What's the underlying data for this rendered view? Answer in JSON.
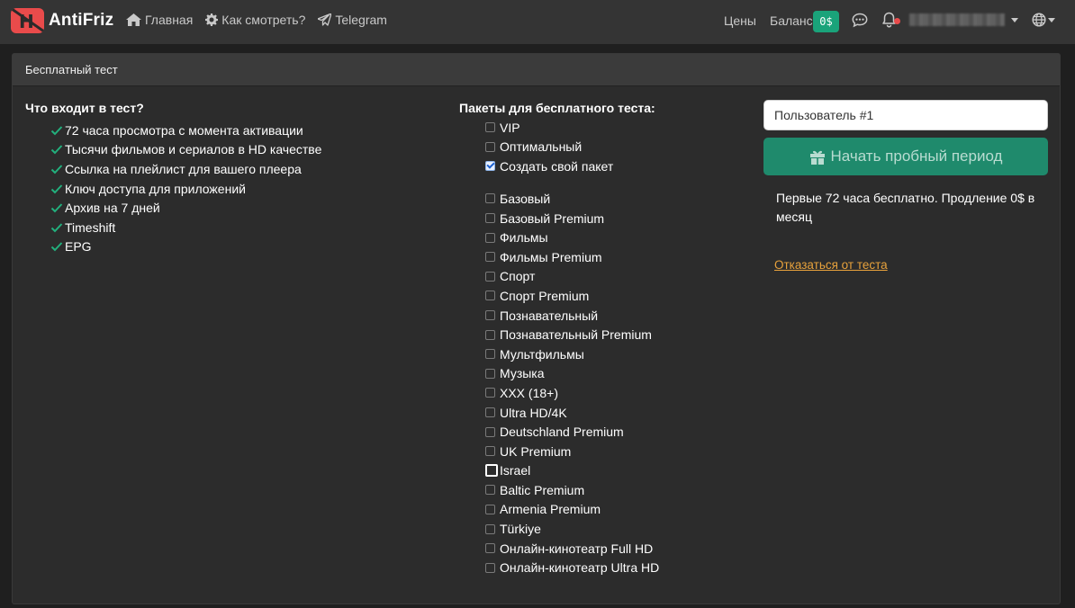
{
  "navbar": {
    "brand": "AntiFriz",
    "brand_logo_letter": "H",
    "links": [
      {
        "label": "Главная",
        "icon": "home-icon"
      },
      {
        "label": "Как смотреть?",
        "icon": "gear-icon"
      },
      {
        "label": "Telegram",
        "icon": "paper-plane-icon"
      }
    ],
    "prices_label": "Цены",
    "balance_label": "Баланс",
    "balance_value": "0$",
    "accent_color": "#1aa37a",
    "brand_color": "#e94b4b"
  },
  "card": {
    "header": "Бесплатный тест",
    "features_title": "Что входит в тест?",
    "features": [
      "72 часа просмотра с момента активации",
      "Тысячи фильмов и сериалов в HD качестве",
      "Ссылка на плейлист для вашего плеера",
      "Ключ доступа для приложений",
      "Архив на 7 дней",
      "Timeshift",
      "EPG"
    ],
    "packages_title": "Пакеты для бесплатного теста:",
    "main_packages": [
      {
        "label": "VIP",
        "checked": false
      },
      {
        "label": "Оптимальный",
        "checked": false
      },
      {
        "label": "Создать свой пакет",
        "checked": true
      }
    ],
    "packages": [
      {
        "label": "Базовый",
        "checked": false
      },
      {
        "label": "Базовый Premium",
        "checked": false
      },
      {
        "label": "Фильмы",
        "checked": false
      },
      {
        "label": "Фильмы Premium",
        "checked": false
      },
      {
        "label": "Спорт",
        "checked": false
      },
      {
        "label": "Спорт Premium",
        "checked": false
      },
      {
        "label": "Познавательный",
        "checked": false
      },
      {
        "label": "Познавательный Premium",
        "checked": false
      },
      {
        "label": "Мультфильмы",
        "checked": false
      },
      {
        "label": "Музыка",
        "checked": false
      },
      {
        "label": "XXX (18+)",
        "checked": false
      },
      {
        "label": "Ultra HD/4K",
        "checked": false
      },
      {
        "label": "Deutschland Premium",
        "checked": false
      },
      {
        "label": "UK Premium",
        "checked": false
      },
      {
        "label": "Israel",
        "checked": false,
        "focused": true
      },
      {
        "label": "Baltic Premium",
        "checked": false
      },
      {
        "label": "Armenia Premium",
        "checked": false
      },
      {
        "label": "Türkiye",
        "checked": false
      },
      {
        "label": "Онлайн-кинотеатр Full HD",
        "checked": false
      },
      {
        "label": "Онлайн-кинотеатр Ultra HD",
        "checked": false
      }
    ],
    "user_input_value": "Пользователь #1",
    "start_button": "Начать пробный период",
    "trial_note": "Первые 72 часа бесплатно. Продление 0$ в месяц",
    "cancel_link": "Отказаться от теста",
    "link_color": "#e8a23c"
  }
}
